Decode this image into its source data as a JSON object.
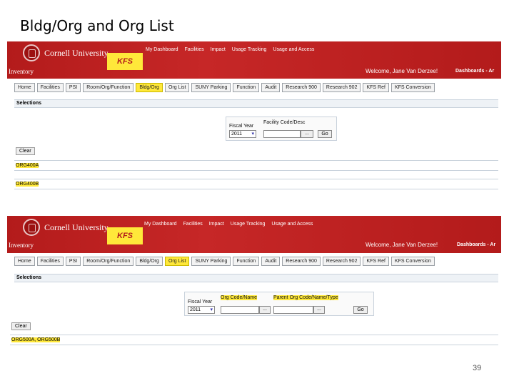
{
  "slide": {
    "title": "Bldg/Org and Org List",
    "page_number": "39"
  },
  "common": {
    "university": "Cornell University",
    "kfs": "KFS",
    "subtitle": "Inventory",
    "welcome": "Welcome, Jane Van Derzee!",
    "dashboards": "Dashboards - Ar",
    "top_links": [
      "My Dashboard",
      "Facilities",
      "Impact",
      "Usage Tracking",
      "Usage and Access"
    ],
    "selections": "Selections",
    "fiscal_year_label": "Fiscal Year",
    "fiscal_year_value": "2011",
    "clear": "Clear",
    "go": "Go",
    "ellipsis": "..."
  },
  "top": {
    "tabs": [
      "Home",
      "Facilities",
      "PSI",
      "Room/Org/Function",
      "Bldg/Org",
      "Org List",
      "SUNY Parking",
      "Function",
      "Audit",
      "Research 900",
      "Research 902",
      "KFS Ref",
      "KFS Conversion"
    ],
    "active_tab": "Bldg/Org",
    "field_label": "Facility Code/Desc",
    "org_a": "ORG400A",
    "org_b": "ORG400B"
  },
  "bottom": {
    "tabs": [
      "Home",
      "Facilities",
      "PSI",
      "Room/Org/Function",
      "Bldg/Org",
      "Org List",
      "SUNY Parking",
      "Function",
      "Audit",
      "Research 900",
      "Research 902",
      "KFS Ref",
      "KFS Conversion"
    ],
    "active_tab": "Org List",
    "org_code_label": "Org Code/Name",
    "parent_label": "Parent Org Code/Name/Type",
    "org_selection": "ORG500A, ORG500B"
  }
}
